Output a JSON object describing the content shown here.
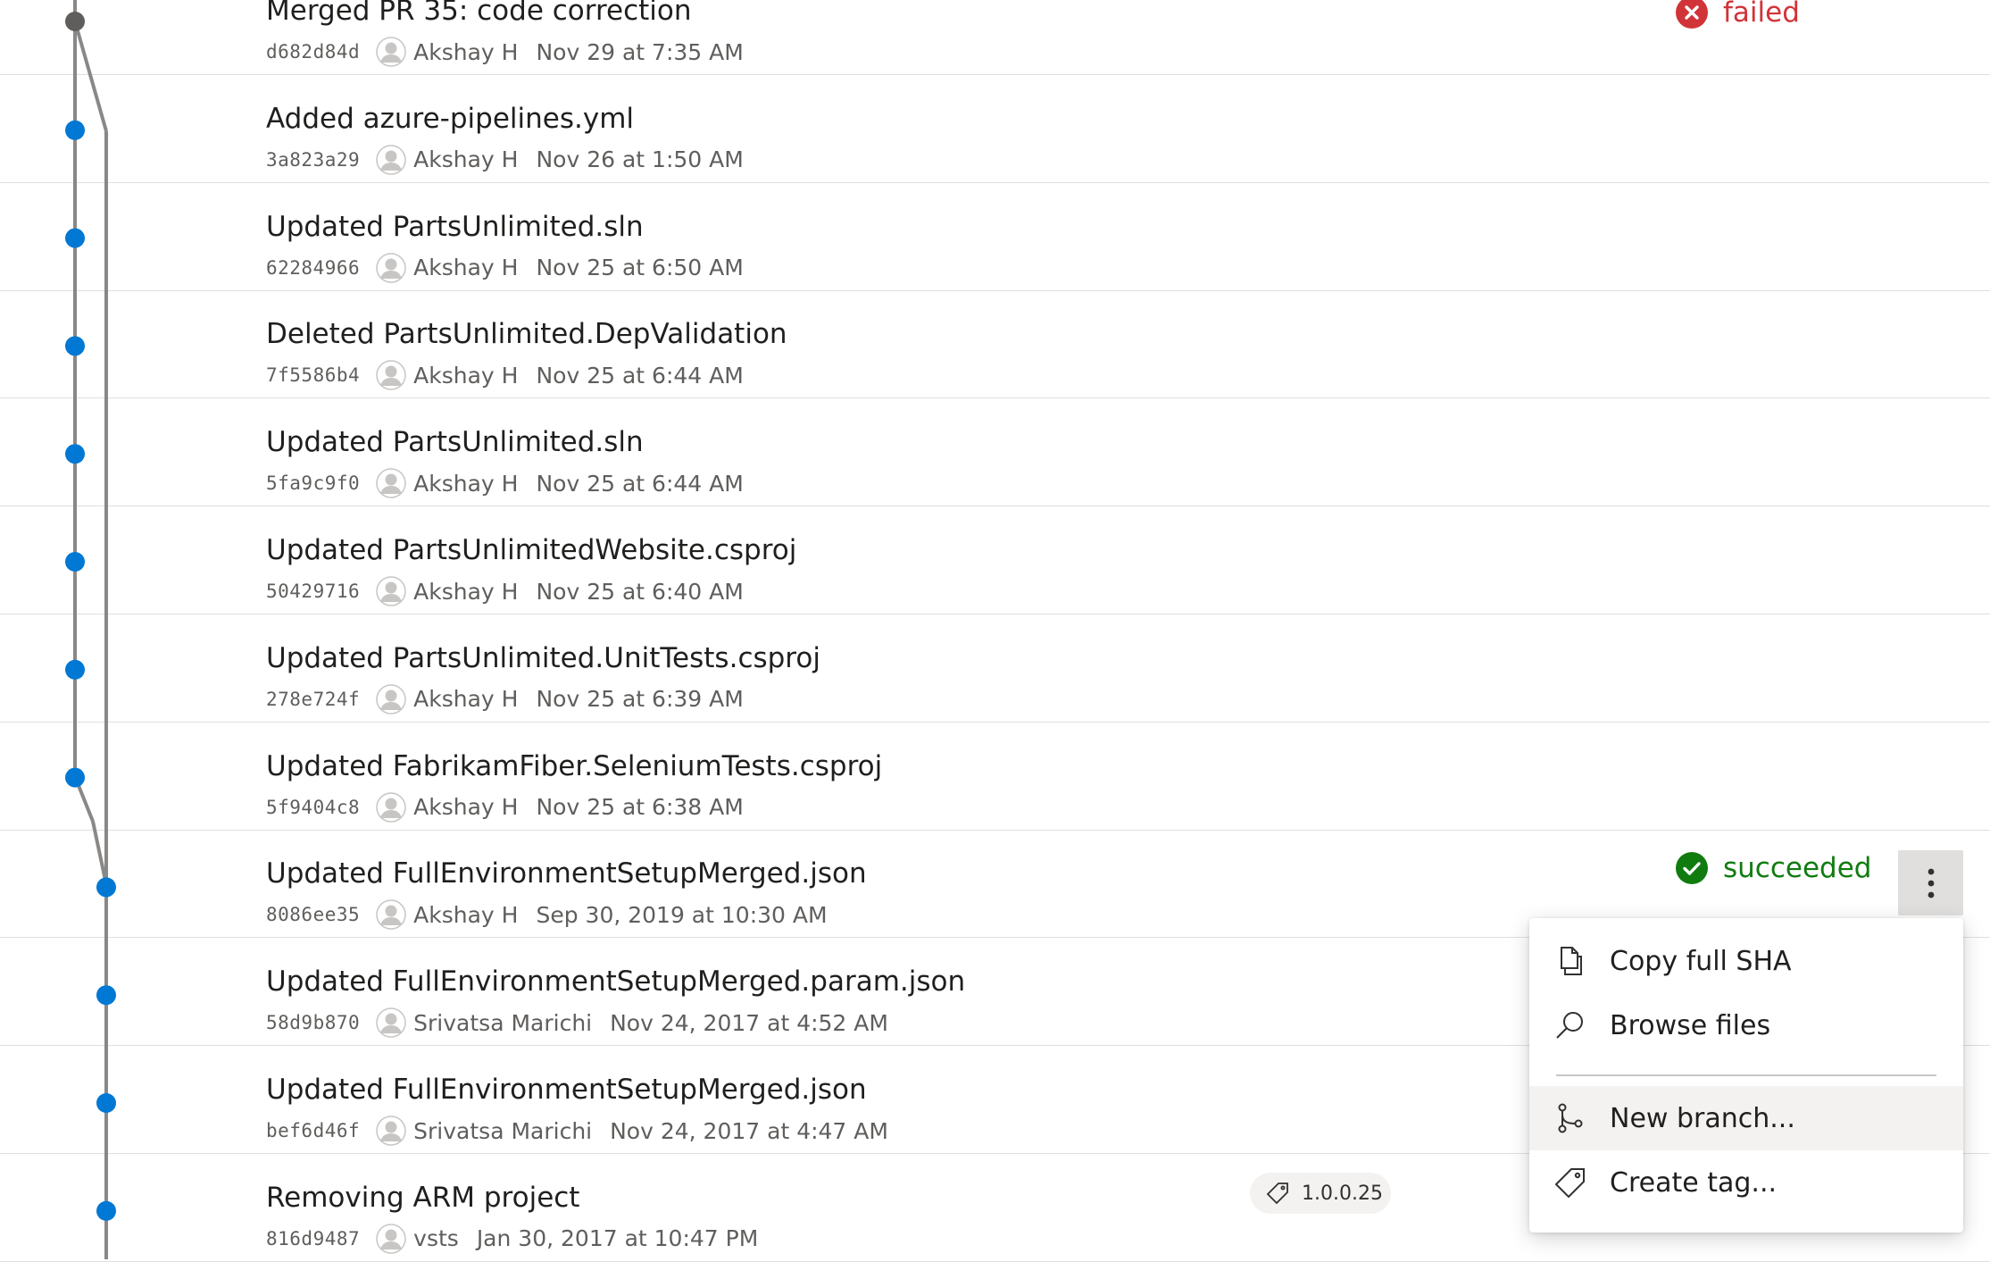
{
  "commits": [
    {
      "title": "Merged PR 35: code correction",
      "sha": "d682d84d",
      "author": "Akshay H",
      "date": "Nov 29 at 7:35 AM",
      "status": "failed"
    },
    {
      "title": "Added azure-pipelines.yml",
      "sha": "3a823a29",
      "author": "Akshay H",
      "date": "Nov 26 at 1:50 AM"
    },
    {
      "title": "Updated PartsUnlimited.sln",
      "sha": "62284966",
      "author": "Akshay H",
      "date": "Nov 25 at 6:50 AM"
    },
    {
      "title": "Deleted PartsUnlimited.DepValidation",
      "sha": "7f5586b4",
      "author": "Akshay H",
      "date": "Nov 25 at 6:44 AM"
    },
    {
      "title": "Updated PartsUnlimited.sln",
      "sha": "5fa9c9f0",
      "author": "Akshay H",
      "date": "Nov 25 at 6:44 AM"
    },
    {
      "title": "Updated PartsUnlimitedWebsite.csproj",
      "sha": "50429716",
      "author": "Akshay H",
      "date": "Nov 25 at 6:40 AM"
    },
    {
      "title": "Updated PartsUnlimited.UnitTests.csproj",
      "sha": "278e724f",
      "author": "Akshay H",
      "date": "Nov 25 at 6:39 AM"
    },
    {
      "title": "Updated FabrikamFiber.SeleniumTests.csproj",
      "sha": "5f9404c8",
      "author": "Akshay H",
      "date": "Nov 25 at 6:38 AM"
    },
    {
      "title": "Updated FullEnvironmentSetupMerged.json",
      "sha": "8086ee35",
      "author": "Akshay H",
      "date": "Sep 30, 2019 at 10:30 AM",
      "status": "succeeded"
    },
    {
      "title": "Updated FullEnvironmentSetupMerged.param.json",
      "sha": "58d9b870",
      "author": "Srivatsa Marichi",
      "date": "Nov 24, 2017 at 4:52 AM"
    },
    {
      "title": "Updated FullEnvironmentSetupMerged.json",
      "sha": "bef6d46f",
      "author": "Srivatsa Marichi",
      "date": "Nov 24, 2017 at 4:47 AM"
    },
    {
      "title": "Removing ARM project",
      "sha": "816d9487",
      "author": "vsts",
      "date": "Jan 30, 2017 at 10:47 PM",
      "tag": "1.0.0.25"
    }
  ],
  "status_labels": {
    "failed": "failed",
    "succeeded": "succeeded"
  },
  "menu": {
    "items": [
      {
        "label": "Copy full SHA",
        "icon": "copy-icon"
      },
      {
        "label": "Browse files",
        "icon": "search-icon"
      },
      {
        "label": "New branch...",
        "icon": "branch-icon"
      },
      {
        "label": "Create tag...",
        "icon": "tag-icon"
      }
    ]
  },
  "colors": {
    "accent": "#0078d4",
    "graph_line": "#8a8886",
    "failed": "#d13438",
    "succeeded": "#107c10",
    "divider": "#e1dfdd"
  }
}
